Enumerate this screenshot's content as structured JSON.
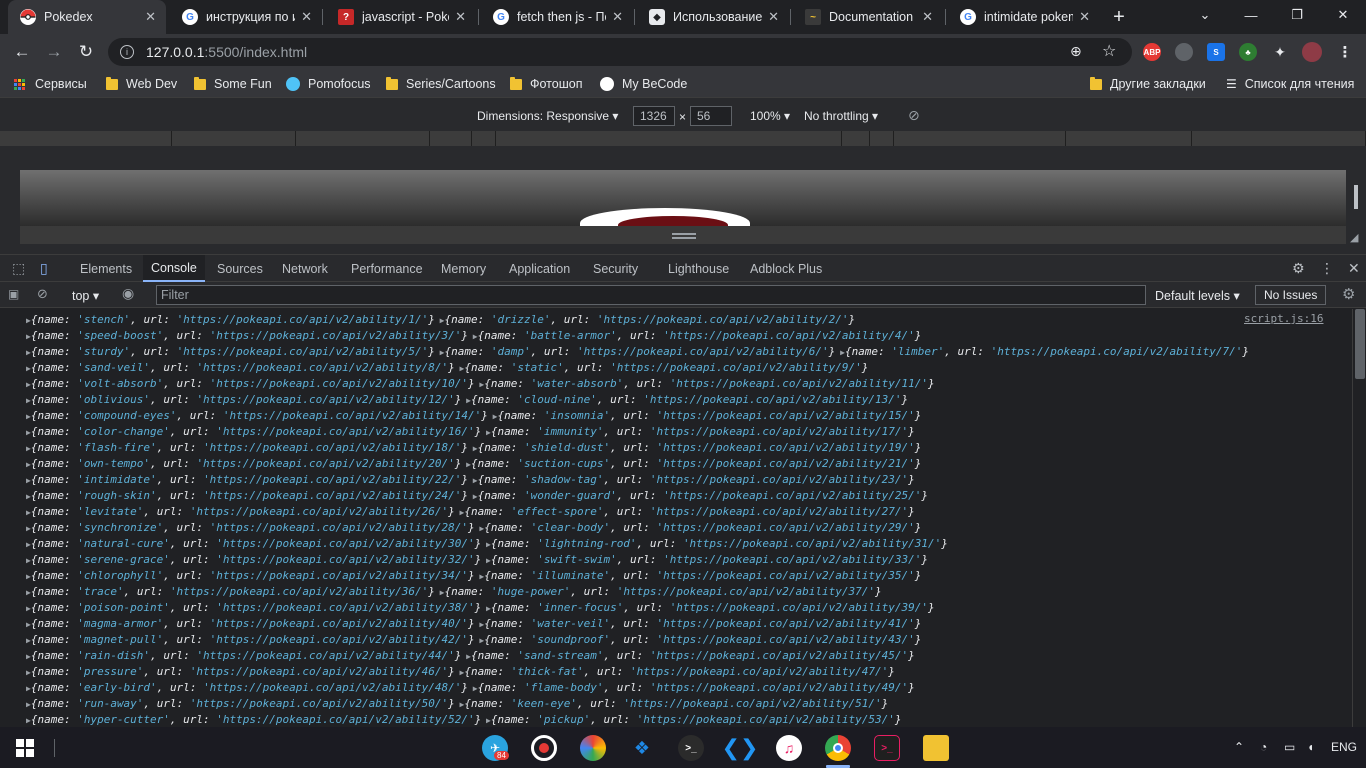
{
  "tabs": [
    {
      "title": "Pokedex",
      "active": true
    },
    {
      "title": "инструкция по и",
      "active": false
    },
    {
      "title": "javascript - PokeA",
      "active": false
    },
    {
      "title": "fetch then js - По",
      "active": false
    },
    {
      "title": "Использование",
      "active": false
    },
    {
      "title": "Documentation",
      "active": false
    },
    {
      "title": "intimidate pokem",
      "active": false
    }
  ],
  "new_tab_label": "+",
  "address": {
    "host": "127.0.0.1",
    "path": ":5500/index.html"
  },
  "bookmarks": {
    "items": [
      "Сервисы",
      "Web Dev",
      "Some Fun",
      "Pomofocus",
      "Series/Cartoons",
      "Фотошоп",
      "My BeCode"
    ],
    "other": "Другие закладки",
    "reading_list": "Список для чтения"
  },
  "device_toolbar": {
    "dimensions": "Dimensions: Responsive",
    "width": "1326",
    "times": "×",
    "height": "56",
    "zoom": "100%",
    "throttling": "No throttling"
  },
  "devtools": {
    "tabs": [
      "Elements",
      "Console",
      "Sources",
      "Network",
      "Performance",
      "Memory",
      "Application",
      "Security",
      "Lighthouse",
      "Adblock Plus"
    ],
    "active_tab": "Console"
  },
  "console_toolbar": {
    "context": "top",
    "filter_placeholder": "Filter",
    "levels": "Default levels",
    "issues": "No Issues"
  },
  "console": {
    "source": "script.js:16",
    "abilities": [
      "stench",
      "drizzle",
      "speed-boost",
      "battle-armor",
      "sturdy",
      "damp",
      "limber",
      "sand-veil",
      "static",
      "volt-absorb",
      "water-absorb",
      "oblivious",
      "cloud-nine",
      "compound-eyes",
      "insomnia",
      "color-change",
      "immunity",
      "flash-fire",
      "shield-dust",
      "own-tempo",
      "suction-cups",
      "intimidate",
      "shadow-tag",
      "rough-skin",
      "wonder-guard",
      "levitate",
      "effect-spore",
      "synchronize",
      "clear-body",
      "natural-cure",
      "lightning-rod",
      "serene-grace",
      "swift-swim",
      "chlorophyll",
      "illuminate",
      "trace",
      "huge-power",
      "poison-point",
      "inner-focus",
      "magma-armor",
      "water-veil",
      "magnet-pull",
      "soundproof",
      "rain-dish",
      "sand-stream",
      "pressure",
      "thick-fat",
      "early-bird",
      "flame-body",
      "run-away",
      "keen-eye",
      "hyper-cutter",
      "pickup"
    ],
    "rows": [
      [
        1,
        2
      ],
      [
        3,
        4
      ],
      [
        5,
        6,
        7
      ],
      [
        8,
        9
      ],
      [
        10,
        11
      ],
      [
        12,
        13
      ],
      [
        14,
        15
      ],
      [
        16,
        17
      ],
      [
        18,
        19
      ],
      [
        20,
        21
      ],
      [
        22,
        23
      ],
      [
        24,
        25
      ],
      [
        26,
        27
      ],
      [
        28,
        29
      ],
      [
        30,
        31
      ],
      [
        32,
        33
      ],
      [
        34,
        35
      ],
      [
        36,
        37
      ],
      [
        38,
        39
      ],
      [
        40,
        41
      ],
      [
        42,
        43
      ],
      [
        44,
        45
      ],
      [
        46,
        47
      ],
      [
        48,
        49
      ],
      [
        50,
        51
      ],
      [
        52,
        53
      ]
    ],
    "url_prefix": "https://pokeapi.co/api/v2/ability/"
  },
  "taskbar": {
    "telegram_badge": "84",
    "language": "ENG"
  }
}
